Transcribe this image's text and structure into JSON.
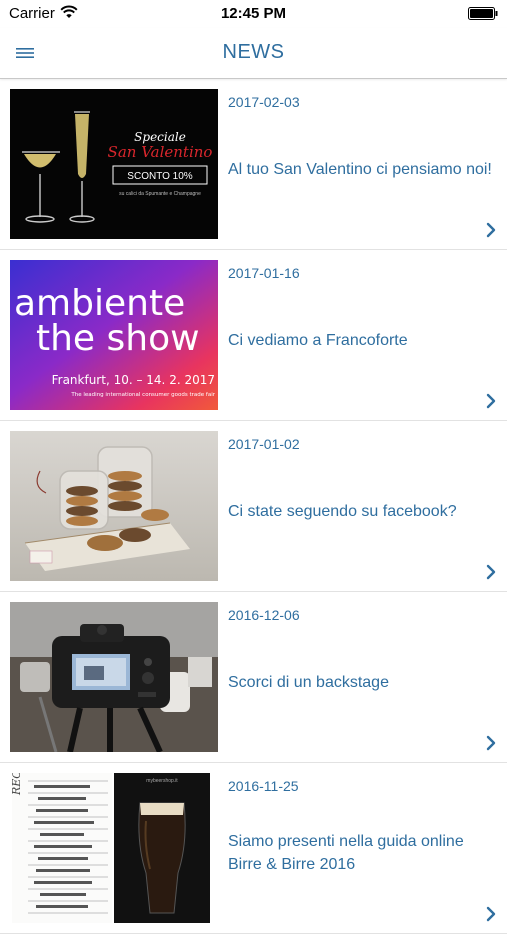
{
  "status_bar": {
    "carrier": "Carrier",
    "time": "12:45 PM"
  },
  "nav": {
    "title": "NEWS",
    "menu_icon": "hamburger-icon"
  },
  "thumb_text": {
    "promo_line1": "Speciale",
    "promo_line2": "San Valentino",
    "promo_badge": "SCONTO 10%",
    "promo_sub": "su calici da Spumante e Champagne",
    "fair_line1": "ambiente",
    "fair_line2": "the show",
    "fair_line3": "Frankfurt, 10. – 14. 2. 2017",
    "fair_line4": "The leading international consumer goods trade fair",
    "guide_header": "REC",
    "guide_site": "mybeershop.it"
  },
  "news": [
    {
      "date": "2017-02-03",
      "title": "Al tuo San Valentino ci pensiamo noi!"
    },
    {
      "date": "2017-01-16",
      "title": "Ci vediamo a Francoforte"
    },
    {
      "date": "2017-01-02",
      "title": "Ci state seguendo su facebook?"
    },
    {
      "date": "2016-12-06",
      "title": "Scorci di un backstage"
    },
    {
      "date": "2016-11-25",
      "title": "Siamo presenti nella guida online Birre & Birre 2016"
    }
  ],
  "colors": {
    "accent": "#2f6e9f",
    "divider": "#e2e2e2"
  }
}
